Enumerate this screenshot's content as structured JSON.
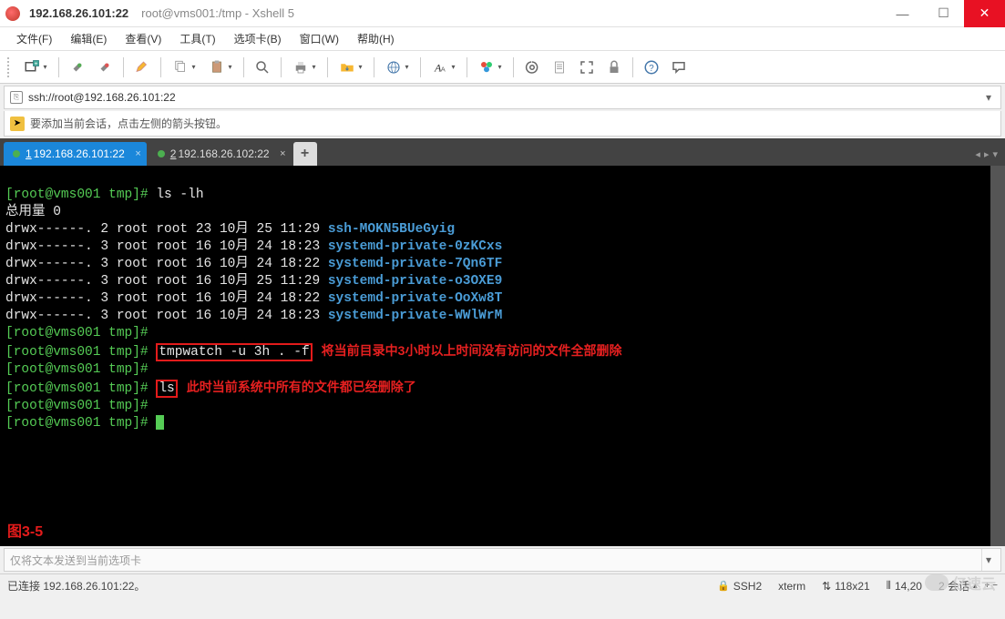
{
  "title": {
    "ip": "192.168.26.101:22",
    "path": "root@vms001:/tmp - Xshell 5"
  },
  "menu": {
    "file": "文件(F)",
    "edit": "编辑(E)",
    "view": "查看(V)",
    "tools": "工具(T)",
    "tabs": "选项卡(B)",
    "window": "窗口(W)",
    "help": "帮助(H)"
  },
  "address": {
    "url": "ssh://root@192.168.26.101:22"
  },
  "hint": {
    "text": "要添加当前会话，点击左侧的箭头按钮。"
  },
  "tabs": {
    "t1_num": "1",
    "t1_label": "192.168.26.101:22",
    "t2_num": "2",
    "t2_label": "192.168.26.102:22",
    "add": "+"
  },
  "term": {
    "l1_prompt": "[root@vms001 tmp]# ",
    "l1_cmd": "ls -lh",
    "l2": "总用量 0",
    "perm_a": "drwx------. 2 root root 23 10月 25 11:29 ",
    "perm_b": "drwx------. 3 root root 16 10月 24 18:23 ",
    "perm_c": "drwx------. 3 root root 16 10月 24 18:22 ",
    "perm_d": "drwx------. 3 root root 16 10月 25 11:29 ",
    "perm_e": "drwx------. 3 root root 16 10月 24 18:22 ",
    "perm_f": "drwx------. 3 root root 16 10月 24 18:23 ",
    "dir_a": "ssh-MOKN5BUeGyig",
    "dir_b": "systemd-private-0zKCxs",
    "dir_c": "systemd-private-7Qn6TF",
    "dir_d": "systemd-private-o3OXE9",
    "dir_e": "systemd-private-OoXw8T",
    "dir_f": "systemd-private-WWlWrM",
    "prompt_bare": "[root@vms001 tmp]#",
    "cmd_tmpwatch": "tmpwatch -u 3h . -f",
    "annot1": "将当前目录中3小时以上时间没有访问的文件全部删除",
    "cmd_ls": "ls",
    "annot2": "此时当前系统中所有的文件都已经删除了",
    "figure": "图3-5"
  },
  "sendbar": {
    "placeholder": "仅将文本发送到当前选项卡"
  },
  "status": {
    "conn": "已连接 192.168.26.101:22。",
    "proto": "SSH2",
    "term": "xterm",
    "size": "118x21",
    "pos": "14,20",
    "sessions": "2 会话",
    "size_arrows": "⇅",
    "pos_icon": "⦀"
  },
  "watermark": "亿速云"
}
